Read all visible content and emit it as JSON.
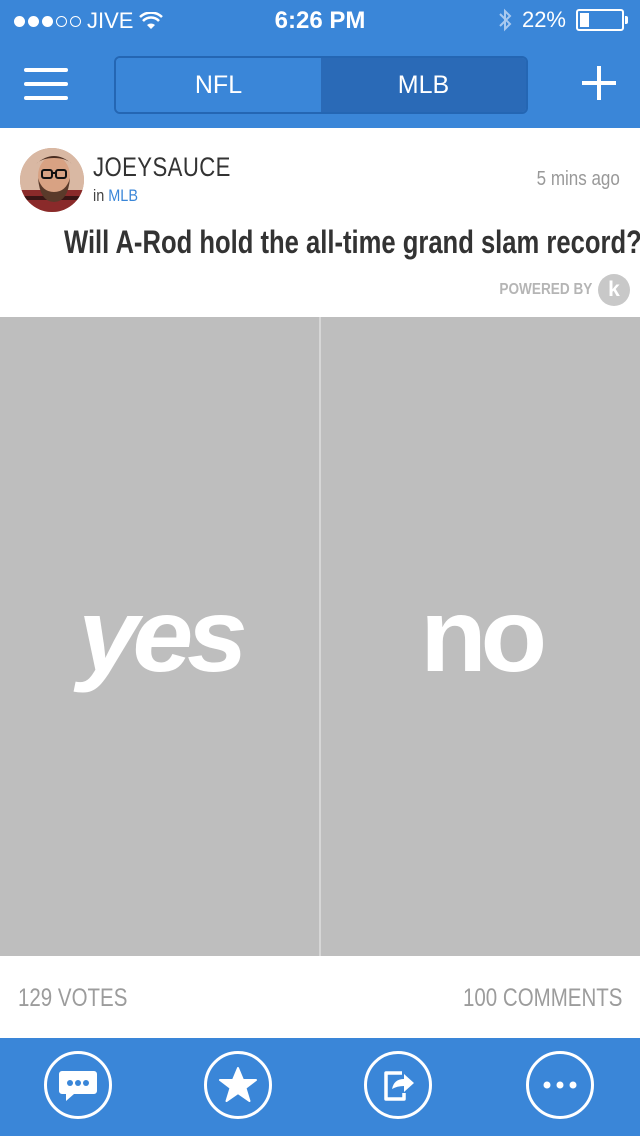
{
  "status_bar": {
    "carrier": "JIVE",
    "time": "6:26 PM",
    "battery": "22%"
  },
  "nav": {
    "tabs": [
      "NFL",
      "MLB"
    ],
    "active_tab": "MLB"
  },
  "post": {
    "username": "JOEYSAUCE",
    "in_prefix": "in",
    "category": "MLB",
    "time_ago": "5 mins ago",
    "question": "Will A-Rod hold the all-time grand slam record?",
    "powered_by": "POWERED BY",
    "powered_logo": "k"
  },
  "vote": {
    "yes_label": "yes",
    "no_label": "no"
  },
  "stats": {
    "votes": "129 VOTES",
    "comments": "100 COMMENTS"
  },
  "tabbar_icons": [
    "chat-icon",
    "star-icon",
    "share-icon",
    "more-icon"
  ],
  "colors": {
    "brand_blue": "#3a86d8",
    "active_segment": "#2a6ab7",
    "panel_gray": "#bebebe"
  }
}
